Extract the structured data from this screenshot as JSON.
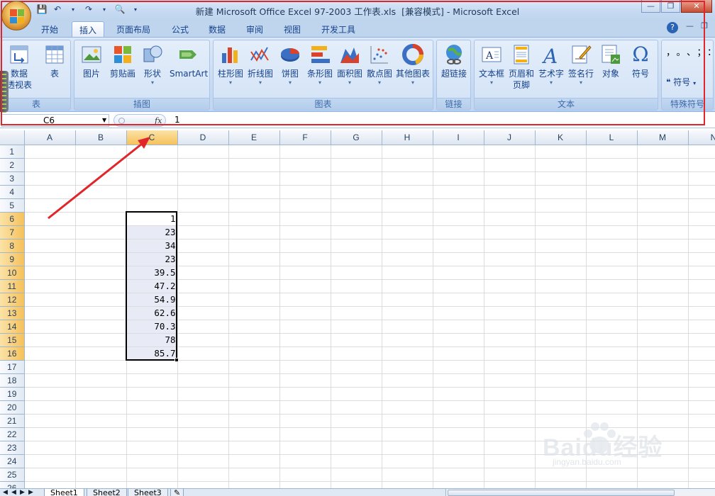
{
  "window": {
    "title": "新建 Microsoft Office Excel 97-2003 工作表.xls  [兼容模式] - Microsoft Excel"
  },
  "tabs": [
    "开始",
    "插入",
    "页面布局",
    "公式",
    "数据",
    "审阅",
    "视图",
    "开发工具"
  ],
  "active_tab": "插入",
  "ribbon": {
    "groups": [
      {
        "label": "表",
        "buttons": [
          {
            "label": "数据",
            "label2": "透视表",
            "icon": "pivot-table-icon"
          },
          {
            "label": "表",
            "icon": "table-icon"
          }
        ]
      },
      {
        "label": "插图",
        "buttons": [
          {
            "label": "图片",
            "icon": "picture-icon"
          },
          {
            "label": "剪贴画",
            "icon": "clip-art-icon"
          },
          {
            "label": "形状",
            "icon": "shapes-icon"
          },
          {
            "label": "SmartArt",
            "icon": "smartart-icon"
          }
        ]
      },
      {
        "label": "图表",
        "buttons": [
          {
            "label": "柱形图",
            "icon": "column-chart-icon"
          },
          {
            "label": "折线图",
            "icon": "line-chart-icon"
          },
          {
            "label": "饼图",
            "icon": "pie-chart-icon"
          },
          {
            "label": "条形图",
            "icon": "bar-chart-icon"
          },
          {
            "label": "面积图",
            "icon": "area-chart-icon"
          },
          {
            "label": "散点图",
            "icon": "scatter-chart-icon"
          },
          {
            "label": "其他图表",
            "icon": "other-charts-icon"
          }
        ]
      },
      {
        "label": "链接",
        "buttons": [
          {
            "label": "超链接",
            "icon": "hyperlink-icon"
          }
        ]
      },
      {
        "label": "文本",
        "buttons": [
          {
            "label": "文本框",
            "icon": "text-box-icon"
          },
          {
            "label": "页眉和",
            "label2": "页脚",
            "icon": "header-footer-icon"
          },
          {
            "label": "艺术字",
            "icon": "wordart-icon"
          },
          {
            "label": "签名行",
            "icon": "signature-line-icon"
          },
          {
            "label": "对象",
            "icon": "object-icon"
          },
          {
            "label": "符号",
            "icon": "symbol-icon"
          }
        ]
      },
      {
        "label": "特殊符号",
        "buttons": [
          {
            "label": "符号",
            "icon": "special-symbol-icon"
          }
        ]
      }
    ],
    "symbol_glyph": "Ω",
    "special_marks": "，。、；：？"
  },
  "formula_bar": {
    "name_box": "C6",
    "fx": "fx",
    "value": "1"
  },
  "sheet": {
    "columns": [
      "A",
      "B",
      "C",
      "D",
      "E",
      "F",
      "G",
      "H",
      "I",
      "J",
      "K",
      "L",
      "M",
      "N"
    ],
    "selected_column": "C",
    "rows": [
      "1",
      "2",
      "3",
      "4",
      "5",
      "6",
      "7",
      "8",
      "9",
      "10",
      "11",
      "12",
      "13",
      "14",
      "15",
      "16",
      "17",
      "18",
      "19",
      "20",
      "21",
      "22",
      "23",
      "24",
      "25",
      "26"
    ],
    "selected_rows": [
      "6",
      "7",
      "8",
      "9",
      "10",
      "11",
      "12",
      "13",
      "14",
      "15",
      "16"
    ],
    "c_values": [
      "1",
      "23",
      "34",
      "23",
      "39.5",
      "47.2",
      "54.9",
      "62.6",
      "70.3",
      "78",
      "85.7"
    ]
  },
  "sheet_tabs": [
    "Sheet1",
    "Sheet2",
    "Sheet3"
  ],
  "active_sheet": "Sheet1",
  "watermark": {
    "main": "Baidu经验",
    "sub": "jingyan.baidu.com"
  },
  "colors": {
    "annotation_red": "#e0262a",
    "selection_orange": "#f6c15a",
    "ribbon_blue": "#c7daf2"
  }
}
